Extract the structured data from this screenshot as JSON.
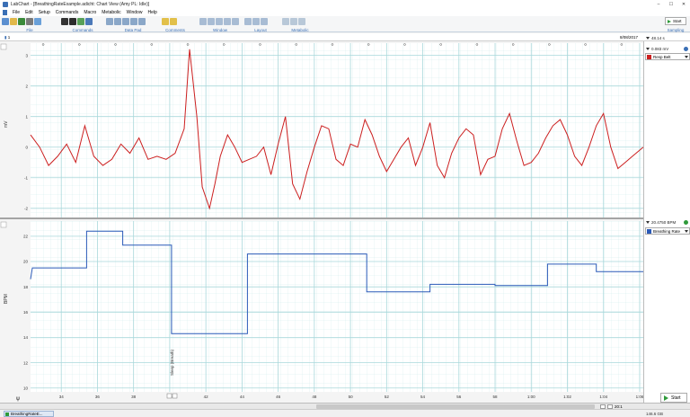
{
  "window": {
    "title": "LabChart - [BreathingRateExample.adicht: Chart View (Amy PL: Idle)]",
    "controls": [
      "–",
      "☐",
      "✕"
    ]
  },
  "menu": [
    "File",
    "Edit",
    "Setup",
    "Commands",
    "Macro",
    "Metabolic",
    "Window",
    "Help"
  ],
  "toolbar": {
    "groups": [
      "File",
      "Commands",
      "Data Pad",
      "Comments",
      "Window",
      "Layout",
      "Metabolic",
      "Sampling"
    ],
    "start_label": "Start"
  },
  "timebar": {
    "page": "1",
    "date": "8/08/2017",
    "duration": "48.14 s"
  },
  "top_channel": {
    "unit_label": "mV",
    "value": "0.083 mV",
    "channel_name": "Resp Belt",
    "color": "#cc1f1f"
  },
  "bottom_channel": {
    "unit_label": "BPM",
    "value": "20.4750 BPM",
    "channel_name": "Breathing Rate",
    "color": "#2a5ab8"
  },
  "comment": "Sleep (Breath)",
  "bottom": {
    "zoom": "20:1",
    "start_label": "Start",
    "disk": "146.6 GB",
    "taskbar_item": "BreathingRateE..."
  },
  "chart_data": [
    {
      "type": "line",
      "ylabel": "mV",
      "ylim": [
        -2.3,
        3.4
      ],
      "yticks": [
        -2,
        -1,
        0,
        1,
        2,
        3
      ],
      "xlim": [
        32.3,
        66.2
      ],
      "x": [
        32.3,
        32.8,
        33.3,
        33.8,
        34.3,
        34.8,
        35.3,
        35.8,
        36.3,
        36.8,
        37.3,
        37.8,
        38.3,
        38.8,
        39.3,
        39.8,
        40.3,
        40.8,
        41.1,
        41.5,
        41.8,
        42.2,
        42.5,
        42.8,
        43.2,
        43.6,
        44.0,
        44.4,
        44.8,
        45.2,
        45.6,
        46.0,
        46.4,
        46.8,
        47.2,
        47.6,
        48.0,
        48.4,
        48.8,
        49.2,
        49.6,
        50.0,
        50.4,
        50.8,
        51.2,
        51.6,
        52.0,
        52.4,
        52.8,
        53.2,
        53.6,
        54.0,
        54.4,
        54.8,
        55.2,
        55.6,
        56.0,
        56.4,
        56.8,
        57.2,
        57.6,
        58.0,
        58.4,
        58.8,
        59.2,
        59.6,
        60.0,
        60.4,
        60.8,
        61.2,
        61.6,
        62.0,
        62.4,
        62.8,
        63.2,
        63.6,
        64.0,
        64.4,
        64.8,
        65.2,
        65.6,
        66.2
      ],
      "y": [
        0.4,
        0.0,
        -0.6,
        -0.3,
        0.1,
        -0.5,
        0.7,
        -0.3,
        -0.6,
        -0.4,
        0.1,
        -0.2,
        0.3,
        -0.4,
        -0.3,
        -0.4,
        -0.2,
        0.6,
        3.2,
        1.0,
        -1.3,
        -2.0,
        -1.2,
        -0.3,
        0.4,
        0.0,
        -0.5,
        -0.4,
        -0.3,
        0.0,
        -0.9,
        0.1,
        1.0,
        -1.2,
        -1.7,
        -0.8,
        0.0,
        0.7,
        0.6,
        -0.4,
        -0.6,
        0.1,
        0.0,
        0.9,
        0.4,
        -0.3,
        -0.8,
        -0.4,
        0.0,
        0.3,
        -0.6,
        0.0,
        0.8,
        -0.6,
        -1.0,
        -0.2,
        0.3,
        0.6,
        0.4,
        -0.9,
        -0.4,
        -0.3,
        0.6,
        1.1,
        0.2,
        -0.6,
        -0.5,
        -0.2,
        0.3,
        0.7,
        0.9,
        0.4,
        -0.3,
        -0.6,
        0.0,
        0.7,
        1.1,
        0.0,
        -0.7,
        -0.5,
        -0.3,
        0.0
      ],
      "series_color": "#cc1f1f"
    },
    {
      "type": "line",
      "ylabel": "BPM",
      "ylim": [
        9.7,
        23.2
      ],
      "yticks": [
        10,
        12,
        14,
        16,
        18,
        20,
        22
      ],
      "xlim": [
        32.3,
        66.2
      ],
      "xticks": [
        "34",
        "36",
        "38",
        "40",
        "42",
        "44",
        "46",
        "48",
        "50",
        "52",
        "54",
        "56",
        "58",
        "1:00",
        "1:02",
        "1:04",
        "1:06"
      ],
      "x": [
        32.3,
        32.4,
        35.4,
        35.4,
        37.4,
        37.4,
        40.1,
        40.1,
        44.3,
        44.3,
        50.9,
        50.9,
        54.4,
        54.4,
        58.0,
        58.0,
        60.9,
        60.9,
        63.6,
        63.6,
        66.2
      ],
      "y": [
        18.6,
        19.5,
        19.5,
        22.4,
        22.4,
        21.3,
        21.3,
        14.3,
        14.3,
        20.6,
        20.6,
        17.6,
        17.6,
        18.2,
        18.2,
        18.1,
        18.1,
        19.8,
        19.8,
        19.2,
        19.2
      ],
      "series_color": "#2a5ab8"
    }
  ]
}
